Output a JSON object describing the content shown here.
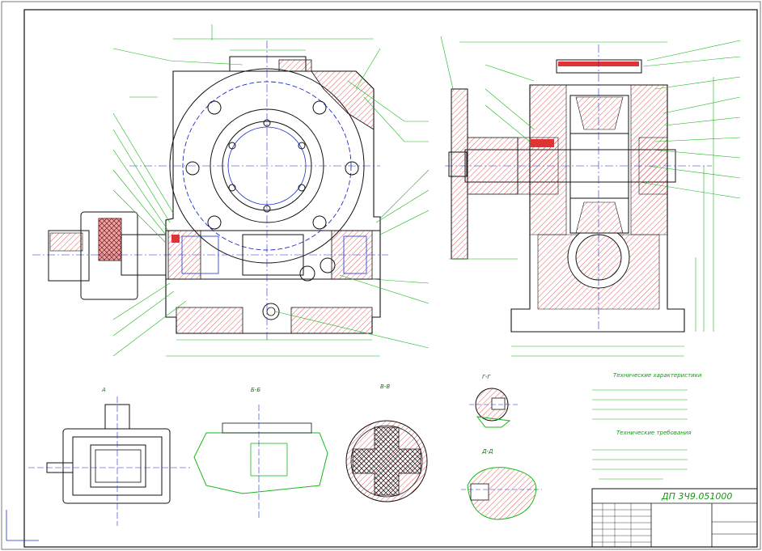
{
  "colors": {
    "outline": "#0a0a0a",
    "blue": "#1b2fd0",
    "green": "#17b817",
    "hatch": "#e03333",
    "text": "#12a012"
  },
  "title_block": {
    "code": "ДП 3Ч9.051000"
  },
  "notes": {
    "heading_1": "Технические характеристики",
    "heading_2": "Технические требования"
  },
  "sections": {
    "a": "А",
    "b_b": "Б-Б",
    "v_v": "В-В",
    "g_g": "Г-Г",
    "d_d": "Д-Д"
  }
}
